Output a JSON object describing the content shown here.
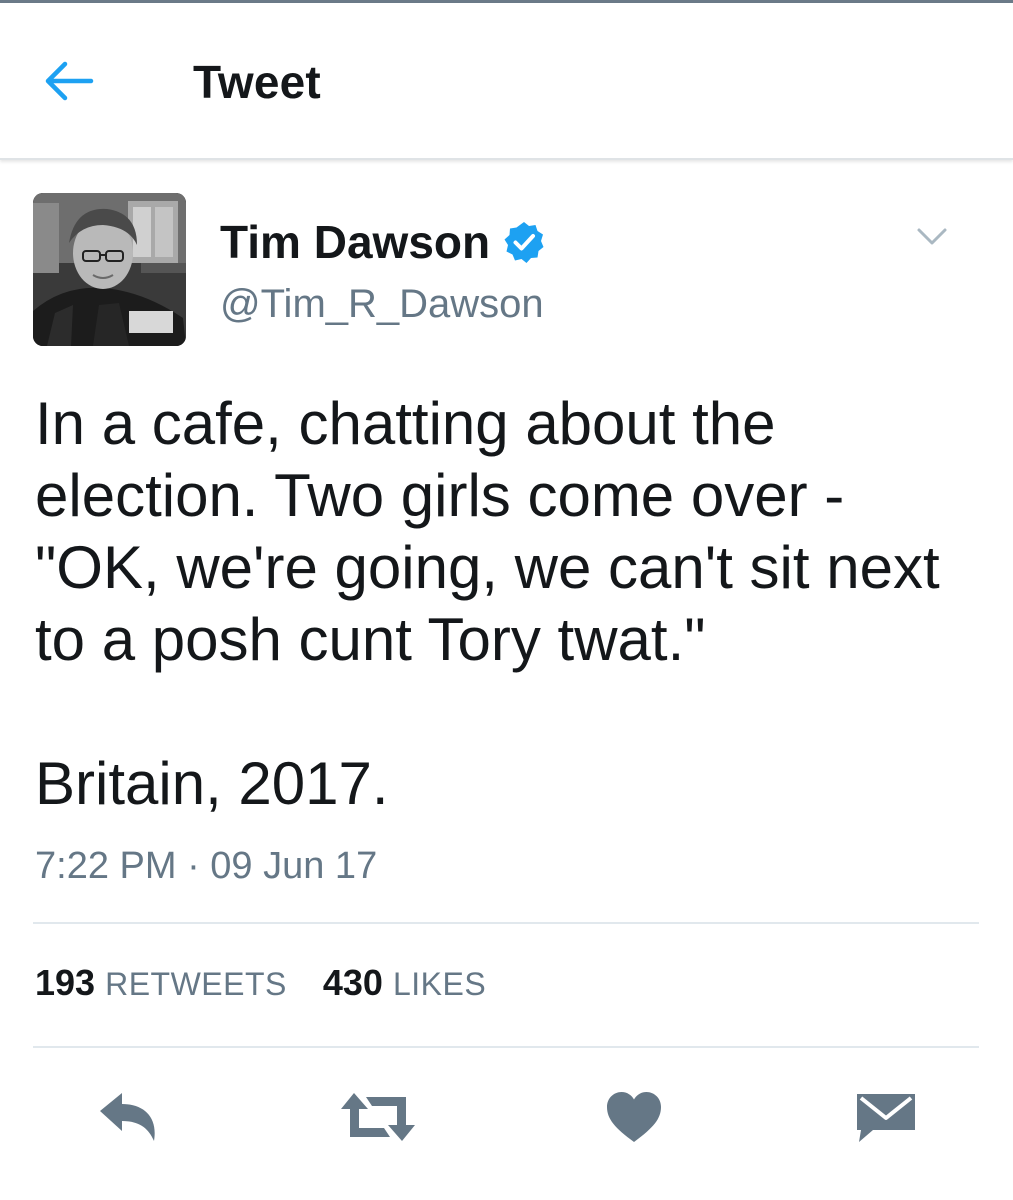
{
  "header": {
    "title": "Tweet",
    "back_icon": "arrow-left-icon"
  },
  "user": {
    "display_name": "Tim Dawson",
    "handle": "@Tim_R_Dawson",
    "verified": true,
    "avatar": "avatar-photo"
  },
  "tweet": {
    "lines": [
      "In a cafe, chatting about the",
      "election. Two girls come over -",
      "\"OK, we're going, we can't sit next",
      "to a posh cunt Tory twat.\""
    ],
    "closing": "Britain, 2017.",
    "timestamp": "7:22 PM · 09 Jun 17"
  },
  "stats": {
    "retweets_count": "193",
    "retweets_label": "RETWEETS",
    "likes_count": "430",
    "likes_label": "LIKES"
  },
  "actions": {
    "reply_icon": "reply-icon",
    "retweet_icon": "retweet-icon",
    "like_icon": "heart-icon",
    "dm_icon": "envelope-icon"
  },
  "colors": {
    "accent": "#1da1f2",
    "text": "#14171a",
    "secondary_text": "#657786",
    "icon_gray": "#657786",
    "divider": "#e1e8ed"
  }
}
